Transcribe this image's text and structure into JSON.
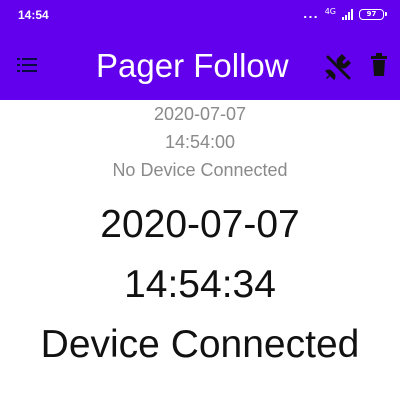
{
  "status_bar": {
    "time": "14:54",
    "signal_label": "4G",
    "battery_level": "97"
  },
  "header": {
    "title": "Pager Follow"
  },
  "last_status": {
    "date": "2020-07-07",
    "time": "14:54:00",
    "message": "No Device Connected"
  },
  "current_status": {
    "date": "2020-07-07",
    "time": "14:54:34",
    "message": "Device Connected"
  },
  "colors": {
    "app_bar": "#6200ee",
    "text_secondary": "#8a8a8a",
    "text_primary": "#111111"
  },
  "icons": {
    "menu": "menu-icon",
    "unplug": "power-plug-off-icon",
    "trash": "trash-icon"
  }
}
